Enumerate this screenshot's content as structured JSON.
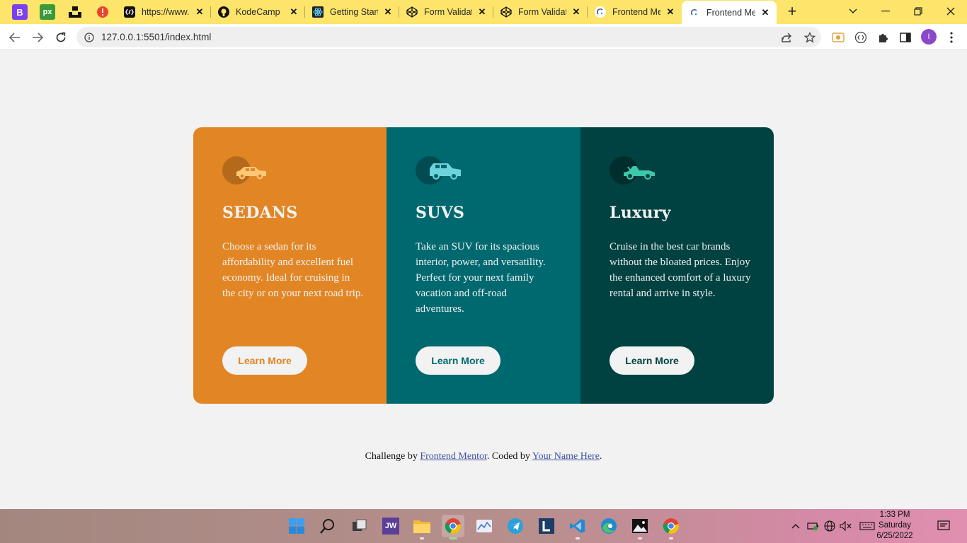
{
  "browser": {
    "tabs": [
      {
        "title": "https://www.",
        "active": false
      },
      {
        "title": "KodeCamp",
        "active": false
      },
      {
        "title": "Getting Start",
        "active": false
      },
      {
        "title": "Form Validat",
        "active": false
      },
      {
        "title": "Form Validat",
        "active": false
      },
      {
        "title": "Frontend Me",
        "active": false
      },
      {
        "title": "Frontend Me",
        "active": true
      }
    ],
    "url": "127.0.0.1:5501/index.html",
    "profile_initial": "I",
    "pinned_labels": [
      "B",
      "px"
    ]
  },
  "cards": [
    {
      "title": "SEDANS",
      "text": "Choose a sedan for its affordability and excellent fuel economy. Ideal for cruising in the city or on your next road trip.",
      "button": "Learn More",
      "color": "#e28625",
      "icon": "sedan-icon"
    },
    {
      "title": "SUVS",
      "text": "Take an SUV for its spacious interior, power, and versatility. Perfect for your next family vacation and off-road adventures.",
      "button": "Learn More",
      "color": "#006970",
      "icon": "suv-icon"
    },
    {
      "title": "Luxury",
      "text": "Cruise in the best car brands without the bloated prices. Enjoy the enhanced comfort of a luxury rental and arrive in style.",
      "button": "Learn More",
      "color": "#004141",
      "icon": "luxury-car-icon"
    }
  ],
  "attribution": {
    "prefix": "Challenge by",
    "link1": "Frontend Mentor",
    "middle": ". Coded by",
    "link2": "Your Name Here",
    "suffix": "."
  },
  "taskbar": {
    "jw_label": "JW",
    "time": "1:33 PM",
    "day": "Saturday",
    "date": "6/25/2022"
  },
  "colors": {
    "tab_strip": "#fde46a",
    "page_background": "#f2f2f2",
    "bright_orange": "#e28625",
    "dark_cyan": "#006970",
    "very_dark_cyan": "#004141"
  }
}
